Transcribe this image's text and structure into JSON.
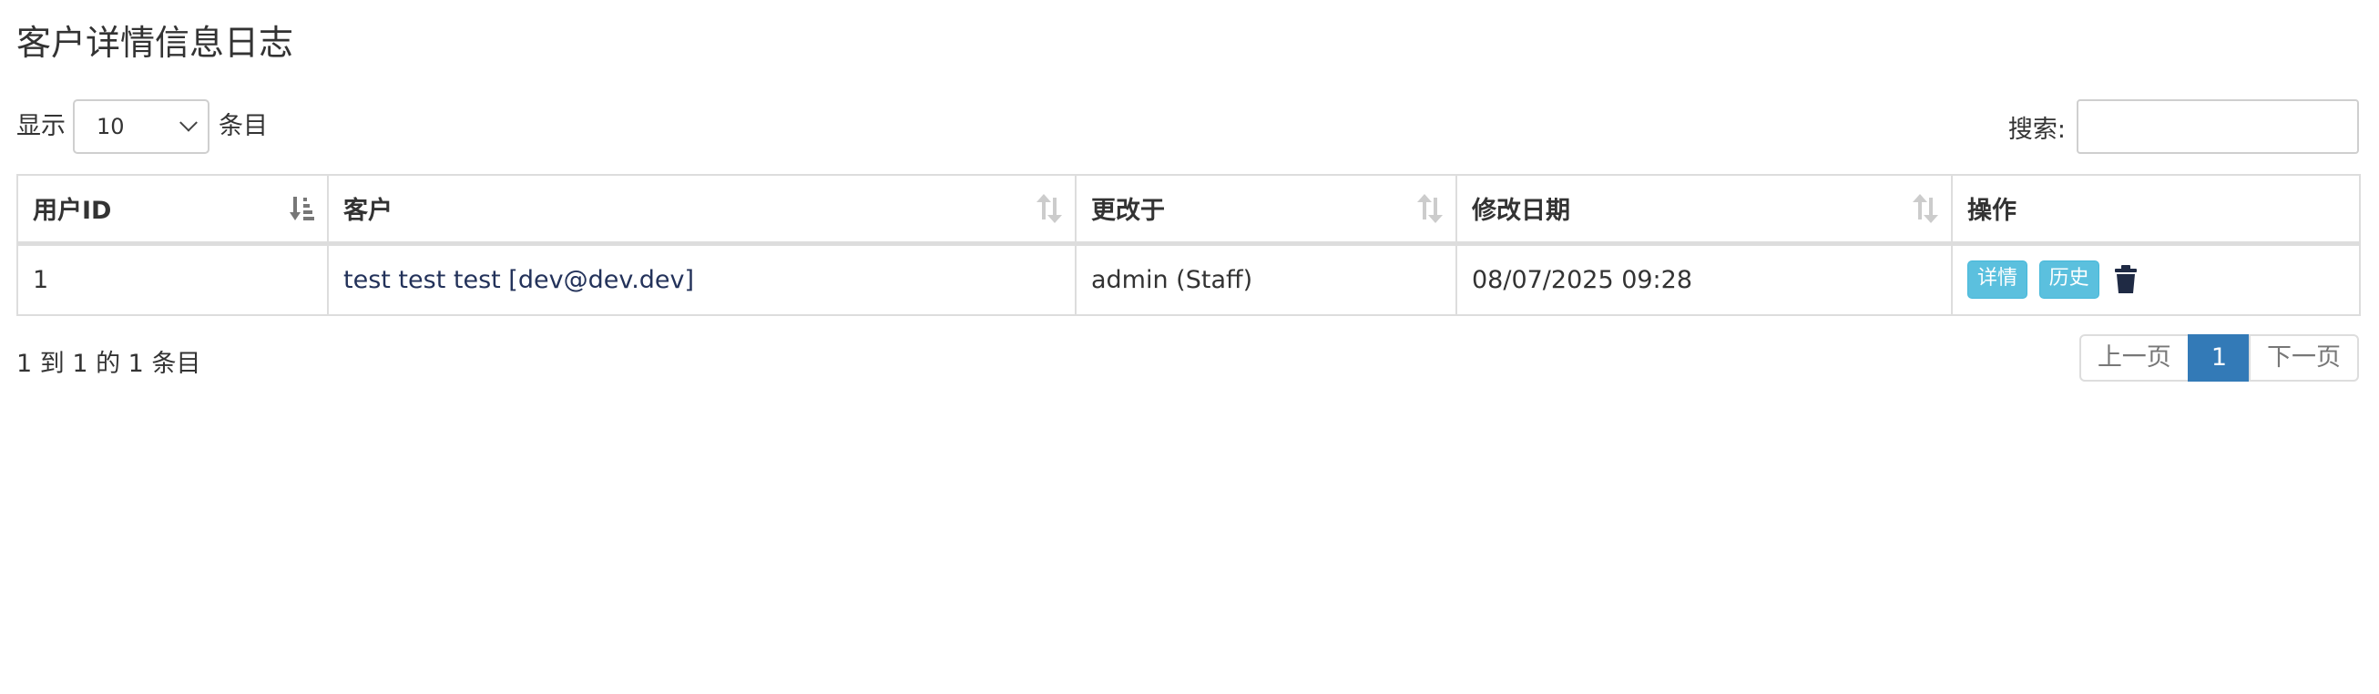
{
  "page": {
    "title": "客户详情信息日志"
  },
  "length_control": {
    "prefix": "显示",
    "selected": "10",
    "suffix": "条目"
  },
  "search": {
    "label": "搜索:",
    "value": "",
    "placeholder": ""
  },
  "table": {
    "columns": [
      "用户ID",
      "客户",
      "更改于",
      "修改日期",
      "操作"
    ],
    "rows": [
      {
        "user_id": "1",
        "customer": "test test test [dev@dev.dev]",
        "changed_by": "admin (Staff)",
        "modified_date": "08/07/2025 09:28",
        "actions": {
          "details": "详情",
          "history": "历史"
        }
      }
    ]
  },
  "footer": {
    "info": "1 到 1 的 1 条目",
    "pagination": {
      "prev": "上一页",
      "current": "1",
      "next": "下一页"
    }
  },
  "colors": {
    "info_button": "#5bc0de",
    "active_page": "#337ab7",
    "link": "#23325a",
    "trash_icon": "#1f2a44"
  },
  "icons": {
    "sort_active": "sort-numeric-asc-icon",
    "sort": "sort-both-icon",
    "delete": "trash-icon",
    "select_arrow": "chevron-down-icon"
  }
}
